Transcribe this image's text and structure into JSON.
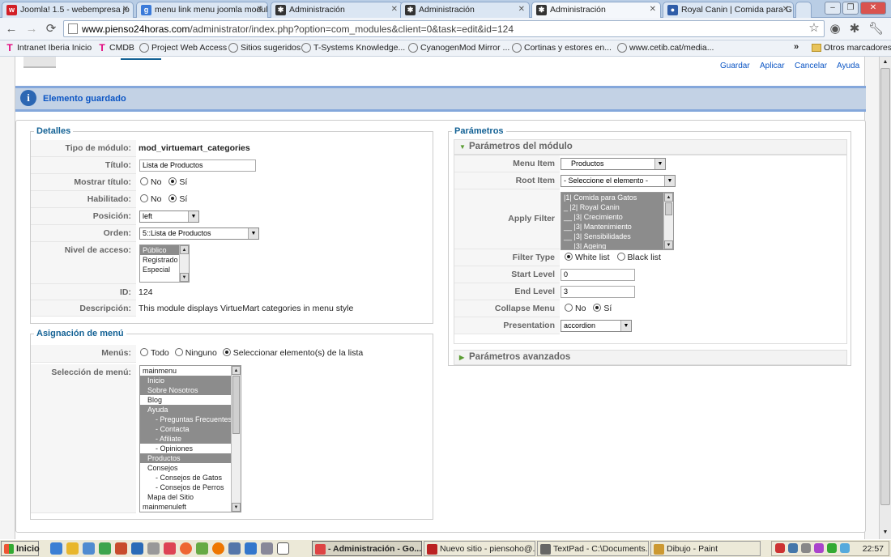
{
  "browser": {
    "tabs": [
      {
        "label": "Joomla! 1.5 - webempresa jo",
        "icon": "webempresa-icon",
        "color": "#d21f26",
        "active": false
      },
      {
        "label": "menu link menu joomla modul",
        "icon": "google-icon",
        "color": "#3a7ad9",
        "active": false
      },
      {
        "label": "Administración",
        "icon": "joomla-icon",
        "color": "#333333",
        "active": false
      },
      {
        "label": "Administración",
        "icon": "joomla-icon",
        "color": "#333333",
        "active": false
      },
      {
        "label": "Administración",
        "icon": "joomla-icon",
        "color": "#333333",
        "active": true
      },
      {
        "label": "Royal Canin | Comida para G",
        "icon": "globe-icon",
        "color": "#2f5da8",
        "active": false
      }
    ],
    "url_domain": "www.pienso24horas.com",
    "url_path": "/administrator/index.php?option=com_modules&client=0&task=edit&id=124",
    "bookmarks": [
      {
        "label": "Intranet Iberia Inicio",
        "icon": "t-icon"
      },
      {
        "label": "CMDB",
        "icon": "t-icon"
      },
      {
        "label": "Project Web Access",
        "icon": "globe-icon"
      },
      {
        "label": "Sitios sugeridos",
        "icon": "globe-icon"
      },
      {
        "label": "T-Systems Knowledge...",
        "icon": "globe-icon"
      },
      {
        "label": "CyanogenMod Mirror ...",
        "icon": "globe-icon"
      },
      {
        "label": "Cortinas y estores en...",
        "icon": "globe-icon"
      },
      {
        "label": "www.cetib.cat/media...",
        "icon": "globe-icon"
      }
    ],
    "other_bookmarks": "Otros marcadores"
  },
  "toolbar": {
    "save": "Guardar",
    "apply": "Aplicar",
    "cancel": "Cancelar",
    "help": "Ayuda"
  },
  "message": "Elemento guardado",
  "details": {
    "legend": "Detalles",
    "labels": {
      "type": "Tipo de módulo:",
      "title": "Título:",
      "show_title": "Mostrar título:",
      "enabled": "Habilitado:",
      "position": "Posición:",
      "order": "Orden:",
      "access": "Nivel de acceso:",
      "id": "ID:",
      "description": "Descripción:"
    },
    "type_value": "mod_virtuemart_categories",
    "title_value": "Lista de Productos",
    "no": "No",
    "yes": "Sí",
    "position_value": "left",
    "order_value": "5::Lista de Productos",
    "access_options": [
      "Público",
      "Registrado",
      "Especial"
    ],
    "id_value": "124",
    "description_value": "This module displays VirtueMart categories in menu style"
  },
  "menu_assignment": {
    "legend": "Asignación de menú",
    "menus_label": "Menús:",
    "all": "Todo",
    "none": "Ninguno",
    "select": "Seleccionar elemento(s) de la lista",
    "selection_label": "Selección de menú:",
    "items": [
      {
        "label": "mainmenu",
        "selected": false,
        "indent": 0
      },
      {
        "label": "Inicio",
        "selected": true,
        "indent": 1
      },
      {
        "label": "Sobre Nosotros",
        "selected": true,
        "indent": 1
      },
      {
        "label": "Blog",
        "selected": false,
        "indent": 1
      },
      {
        "label": "Ayuda",
        "selected": true,
        "indent": 1
      },
      {
        "label": "- Preguntas Frecuentes",
        "selected": true,
        "indent": 2
      },
      {
        "label": "- Contacta",
        "selected": true,
        "indent": 2
      },
      {
        "label": "- Afiliate",
        "selected": true,
        "indent": 2
      },
      {
        "label": "- Opiniones",
        "selected": false,
        "indent": 2
      },
      {
        "label": "Productos",
        "selected": true,
        "indent": 1
      },
      {
        "label": "Consejos",
        "selected": false,
        "indent": 1
      },
      {
        "label": "- Consejos de Gatos",
        "selected": false,
        "indent": 2
      },
      {
        "label": "- Consejos de Perros",
        "selected": false,
        "indent": 2
      },
      {
        "label": "Mapa del Sitio",
        "selected": false,
        "indent": 1
      },
      {
        "label": "mainmenuleft",
        "selected": false,
        "indent": 0
      }
    ]
  },
  "params": {
    "legend": "Parámetros",
    "module_header": "Parámetros del módulo",
    "advanced_header": "Parámetros avanzados",
    "labels": {
      "menu_item": "Menu Item",
      "root_item": "Root Item",
      "apply_filter": "Apply Filter",
      "filter_type": "Filter Type",
      "start_level": "Start Level",
      "end_level": "End Level",
      "collapse_menu": "Collapse Menu",
      "presentation": "Presentation"
    },
    "menu_item_value": "Productos",
    "root_item_value": "- Seleccione el elemento -",
    "filter_items": [
      "|1| Comida para Gatos",
      "_ |2| Royal Canin",
      "__ |3| Crecimiento",
      "__ |3| Mantenimiento",
      "__ |3| Sensibilidades",
      "__ |3| Ageing"
    ],
    "white_list": "White list",
    "black_list": "Black list",
    "start_level_value": "0",
    "end_level_value": "3",
    "no": "No",
    "yes": "Sí",
    "presentation_value": "accordion"
  },
  "taskbar": {
    "start": "Inicio",
    "tasks": [
      {
        "label": "- Administración - Go...",
        "icon": "chrome-icon",
        "color": "#d44",
        "active": true
      },
      {
        "label": "Nuevo sitio - piensoho@...",
        "icon": "filezilla-icon",
        "color": "#b22",
        "active": false
      },
      {
        "label": "TextPad - C:\\Documents...",
        "icon": "textpad-icon",
        "color": "#666",
        "active": false
      },
      {
        "label": "Dibujo - Paint",
        "icon": "paint-icon",
        "color": "#c93",
        "active": false
      }
    ],
    "clock": "22:57"
  }
}
